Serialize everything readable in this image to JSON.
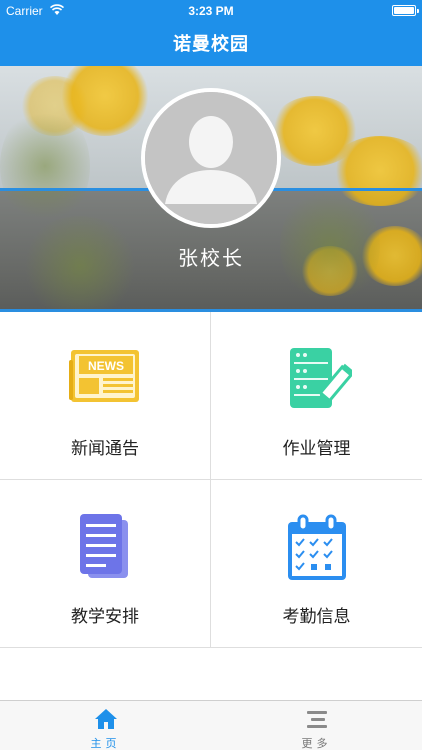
{
  "status_bar": {
    "carrier": "Carrier",
    "time": "3:23 PM"
  },
  "nav": {
    "title": "诺曼校园"
  },
  "profile": {
    "name": "张校长"
  },
  "menu": [
    {
      "label": "新闻通告",
      "icon": "news-icon"
    },
    {
      "label": "作业管理",
      "icon": "homework-icon"
    },
    {
      "label": "教学安排",
      "icon": "document-icon"
    },
    {
      "label": "考勤信息",
      "icon": "calendar-check-icon"
    }
  ],
  "news_icon_text": "NEWS",
  "tabbar": [
    {
      "label": "主页",
      "icon": "home-icon"
    },
    {
      "label": "更多",
      "icon": "menu-lines-icon"
    }
  ],
  "colors": {
    "primary": "#1e90ea",
    "news_yellow": "#f3c332",
    "homework_green": "#3ad1a3",
    "doc_purple": "#6d74e8",
    "calendar_blue": "#2b8ef0"
  }
}
